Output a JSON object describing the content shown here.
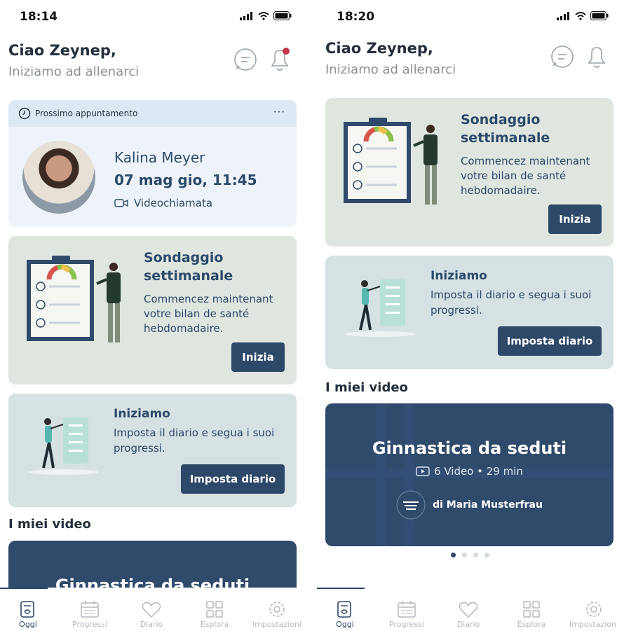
{
  "screens": [
    {
      "status": {
        "time": "18:14"
      },
      "header": {
        "greeting": "Ciao Zeynep,",
        "subtitle": "Iniziamo ad allenarci"
      },
      "appointment": {
        "label": "Prossimo appuntamento",
        "more": "···",
        "name": "Kalina Meyer",
        "datetime": "07 mag gio, 11:45",
        "type": "Videochiamata"
      },
      "survey": {
        "title_line1": "Sondaggio",
        "title_line2": "settimanale",
        "text_line1": "Commencez maintenant",
        "text_line2": "votre bilan de santé",
        "text_line3": "hebdomadaire.",
        "button": "Inizia"
      },
      "diary": {
        "title": "Iniziamo",
        "text_line1": "Imposta il diario e segua i suoi",
        "text_line2": "progressi.",
        "button": "Imposta diario"
      },
      "videos": {
        "section": "I miei video",
        "title": "Ginnastica da seduti"
      }
    },
    {
      "status": {
        "time": "18:20"
      },
      "header": {
        "greeting": "Ciao Zeynep,",
        "subtitle": "Iniziamo ad allenarci"
      },
      "survey": {
        "title_line1": "Sondaggio",
        "title_line2": "settimanale",
        "text_line1": "Commencez maintenant",
        "text_line2": "votre bilan de santé",
        "text_line3": "hebdomadaire.",
        "button": "Inizia"
      },
      "diary": {
        "title": "Iniziamo",
        "text_line1": "Imposta il diario e segua i suoi",
        "text_line2": "progressi.",
        "button": "Imposta diario"
      },
      "videos": {
        "section": "I miei video",
        "title": "Ginnastica da seduti",
        "meta": "6 Video • 29 min",
        "author": "di Maria Musterfrau"
      }
    }
  ],
  "tabs": [
    "Oggi",
    "Progressi",
    "Diario",
    "Esplora",
    "Impostazioni"
  ],
  "colors": {
    "primary": "#2d4868",
    "survey_bg": "#dfe5df",
    "diary_bg": "#d5e1e3",
    "appt_bg": "#eef3f9",
    "notification_dot": "#c0364a"
  }
}
